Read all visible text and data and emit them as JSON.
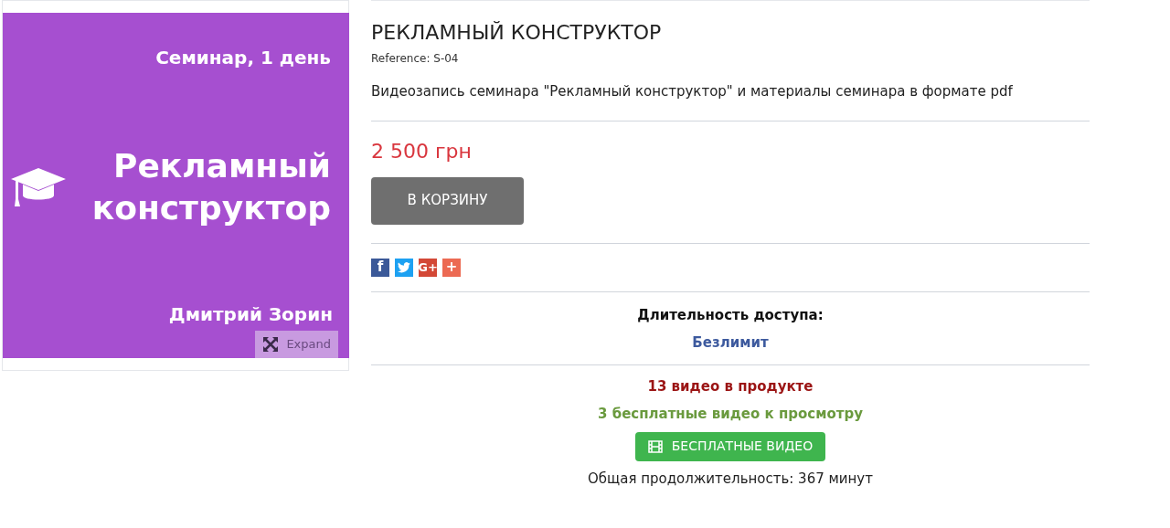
{
  "product_image": {
    "subtitle": "Семинар, 1 день",
    "title_lines": [
      "Рекламный",
      "конструктор"
    ],
    "author": "Дмитрий Зорин",
    "expand_label": "Expand"
  },
  "product": {
    "title": "РЕКЛАМНЫЙ КОНСТРУКТОР",
    "reference": "Reference: S-04",
    "description": "Видеозапись семинара \"Рекламный конструктор\" и материалы семинара в формате pdf",
    "price": "2 500 грн",
    "cart_button": "В КОРЗИНУ"
  },
  "share_buttons": [
    {
      "kind": "facebook",
      "glyph": "f",
      "color": "#3b5998"
    },
    {
      "kind": "twitter",
      "color": "#1da1f2"
    },
    {
      "kind": "googleplus",
      "glyph": "G+",
      "color": "#d34836"
    },
    {
      "kind": "more",
      "glyph": "+",
      "color": "#ec6a53"
    }
  ],
  "access": {
    "label": "Длительность доступа:",
    "value": "Безлимит"
  },
  "videos": {
    "count": "13 видео в продукте",
    "free": "3 бесплатные видео к просмотру",
    "free_button": "БЕСПЛАТНЫЕ ВИДЕО",
    "total": "Общая продолжительность: 367 минут"
  }
}
